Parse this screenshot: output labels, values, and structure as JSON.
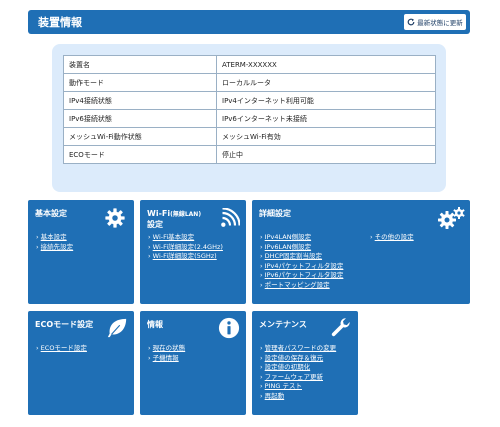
{
  "header": {
    "title": "装置情報",
    "refresh_label": "最新状態に更新"
  },
  "info_table": [
    {
      "label": "装置名",
      "value": "ATERM-XXXXXX"
    },
    {
      "label": "動作モード",
      "value": "ローカルルータ"
    },
    {
      "label": "IPv4接続状態",
      "value": "IPv4インターネット利用可能"
    },
    {
      "label": "IPv6接続状態",
      "value": "IPv6インターネット未接続"
    },
    {
      "label": "メッシュWi-Fi動作状態",
      "value": "メッシュWi-Fi有効"
    },
    {
      "label": "ECOモード",
      "value": "停止中"
    }
  ],
  "tiles": {
    "basic": {
      "title": "基本設定",
      "icon": "gear-icon",
      "links": [
        "基本設定",
        "接続先設定"
      ]
    },
    "wifi": {
      "title": "Wi-Fi",
      "title_sub": "(無線LAN)",
      "title_line2": "設定",
      "icon": "wifi-icon",
      "links": [
        "Wi-Fi基本設定",
        "Wi-Fi詳細設定(2.4GHz)",
        "Wi-Fi詳細設定(5GHz)"
      ]
    },
    "advanced": {
      "title": "詳細設定",
      "icon": "gears-icon",
      "links": [
        "IPv4LAN側設定",
        "IPv6LAN側設定",
        "DHCP固定割当設定",
        "IPv4パケットフィルタ設定",
        "IPv6パケットフィルタ設定",
        "ポートマッピング設定"
      ],
      "links_right": [
        "その他の設定"
      ]
    },
    "eco": {
      "title": "ECOモード設定",
      "icon": "leaf-icon",
      "links": [
        "ECOモード設定"
      ]
    },
    "info": {
      "title": "情報",
      "icon": "info-icon",
      "links": [
        "現在の状態",
        "子機情報"
      ]
    },
    "maint": {
      "title": "メンテナンス",
      "icon": "wrench-icon",
      "links": [
        "管理者パスワードの変更",
        "設定値の保存＆復元",
        "設定値の初期化",
        "ファームウェア更新",
        "PING テスト",
        "再起動"
      ]
    }
  }
}
